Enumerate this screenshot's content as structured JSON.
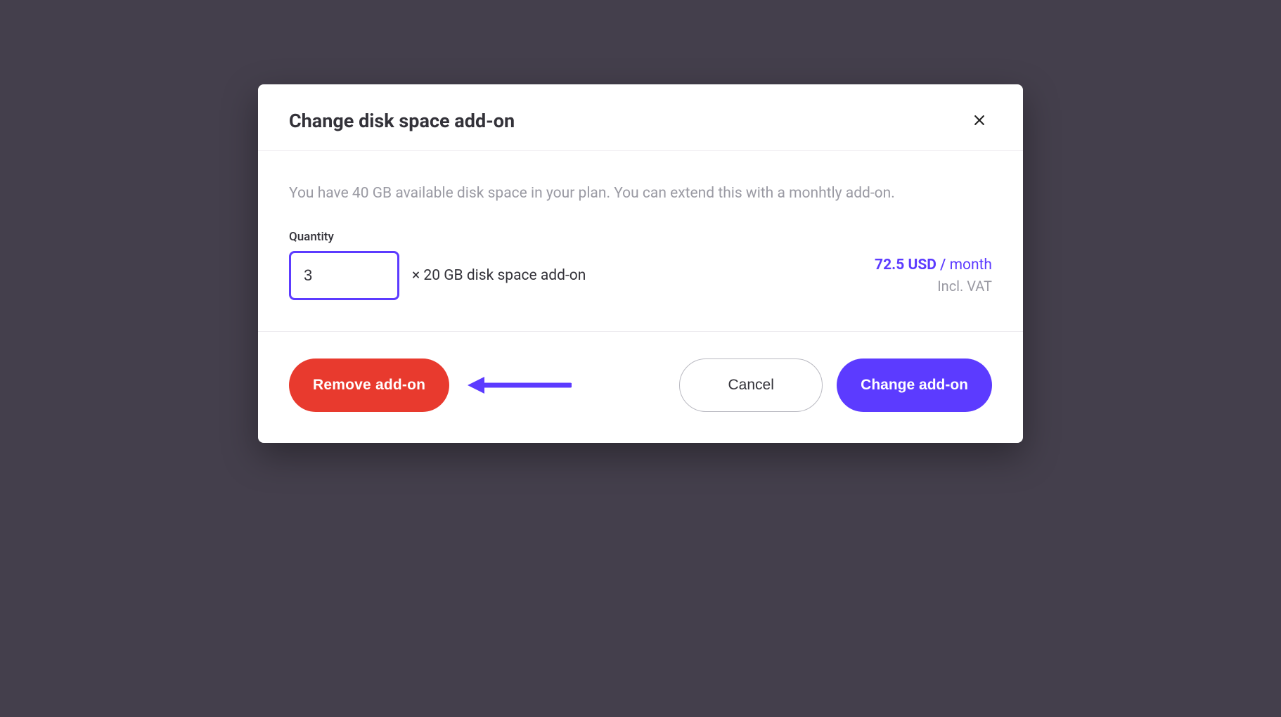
{
  "modal": {
    "title": "Change disk space add-on",
    "close_label": "Close",
    "description": "You have 40 GB available disk space in your plan. You can extend this with a monhtly add-on.",
    "quantity": {
      "label": "Quantity",
      "value": "3",
      "unit_label": "× 20 GB disk space add-on"
    },
    "price": {
      "amount": "72.5 USD",
      "separator": " / ",
      "period": "month",
      "vat_note": "Incl. VAT"
    },
    "buttons": {
      "remove": "Remove add-on",
      "cancel": "Cancel",
      "change": "Change add-on"
    }
  },
  "colors": {
    "background": "#443f4c",
    "accent": "#5c3bff",
    "danger": "#e83a2e",
    "text_primary": "#333239",
    "text_muted": "#9a9aa3",
    "border": "#eceaee"
  }
}
